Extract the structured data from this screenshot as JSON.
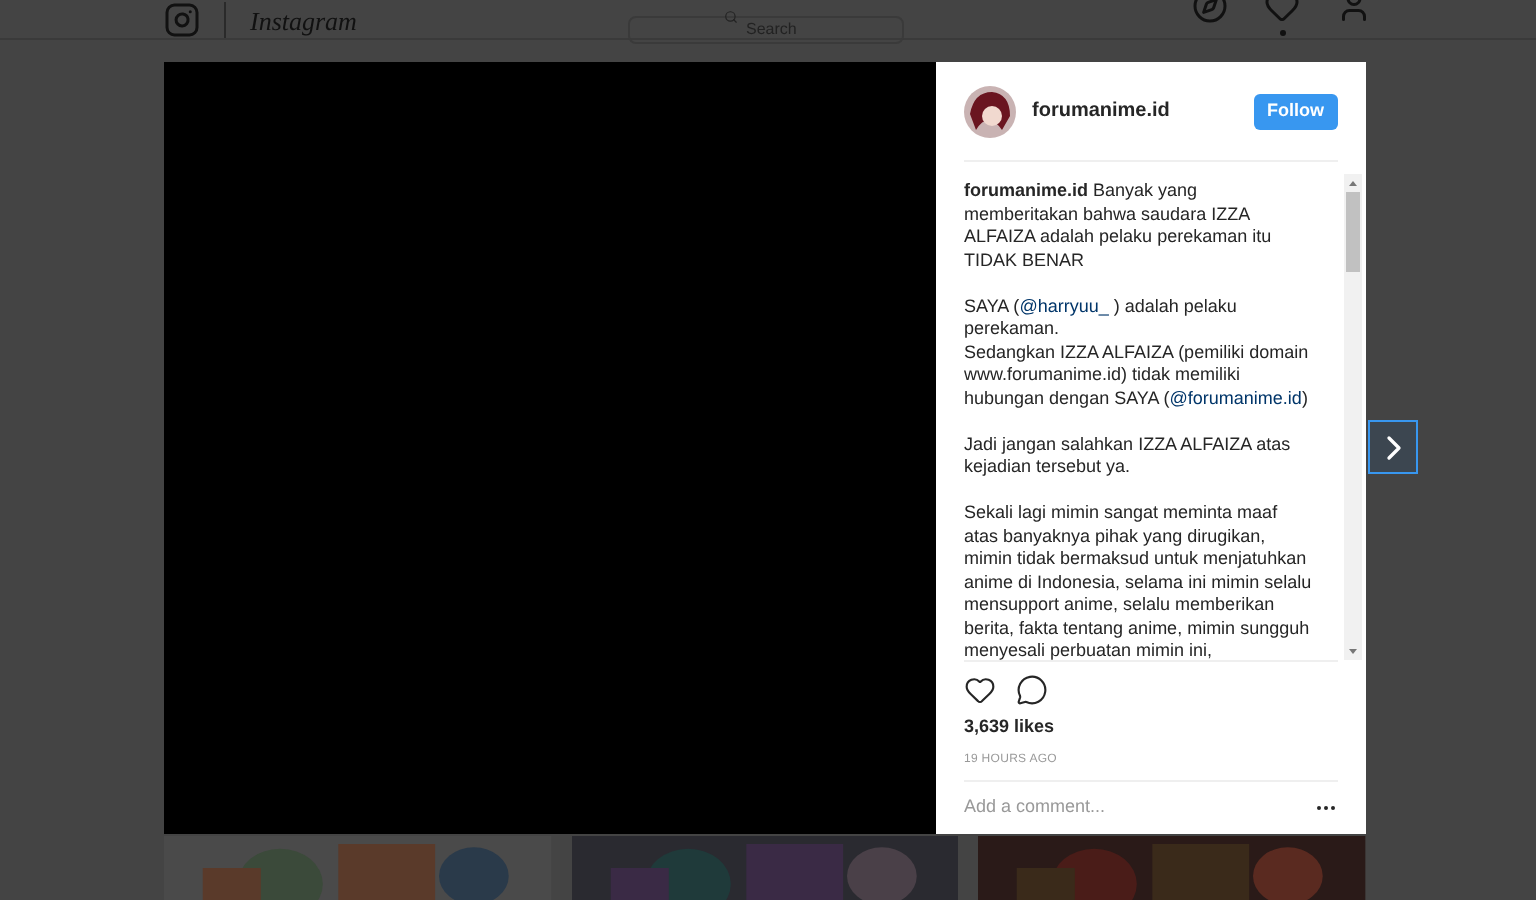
{
  "header": {
    "logo_text": "Instagram",
    "search": {
      "placeholder": "Search"
    },
    "has_activity": true
  },
  "post": {
    "author": "forumanime.id",
    "follow_label": "Follow",
    "caption_author": "forumanime.id",
    "caption": [
      [
        {
          "text": " Banyak yang memberitakan bahwa saudara IZZA ALFAIZA adalah pelaku perekaman itu TIDAK BENAR"
        }
      ],
      [
        {
          "text": "SAYA ("
        },
        {
          "text": "@harryuu_",
          "kind": "mention"
        },
        {
          "text": " ) adalah pelaku perekaman.\nSedangkan IZZA ALFAIZA (pemiliki domain www.forumanime.id) tidak memiliki hubungan dengan SAYA ("
        },
        {
          "text": "@forumanime.id",
          "kind": "mention"
        },
        {
          "text": ")"
        }
      ],
      [
        {
          "text": "Jadi jangan salahkan IZZA ALFAIZA atas kejadian tersebut ya."
        }
      ],
      [
        {
          "text": "Sekali lagi mimin sangat meminta maaf atas banyaknya pihak yang dirugikan, mimin tidak bermaksud untuk menjatuhkan anime di Indonesia, selama ini mimin selalu mensupport anime, selalu memberikan berita, fakta tentang anime, mimin sungguh menyesali perbuatan mimin ini,"
        }
      ]
    ],
    "liked": false,
    "likes": "3,639 likes",
    "time": "19 HOURS AGO",
    "comment": {
      "placeholder": "Add a comment..."
    }
  }
}
